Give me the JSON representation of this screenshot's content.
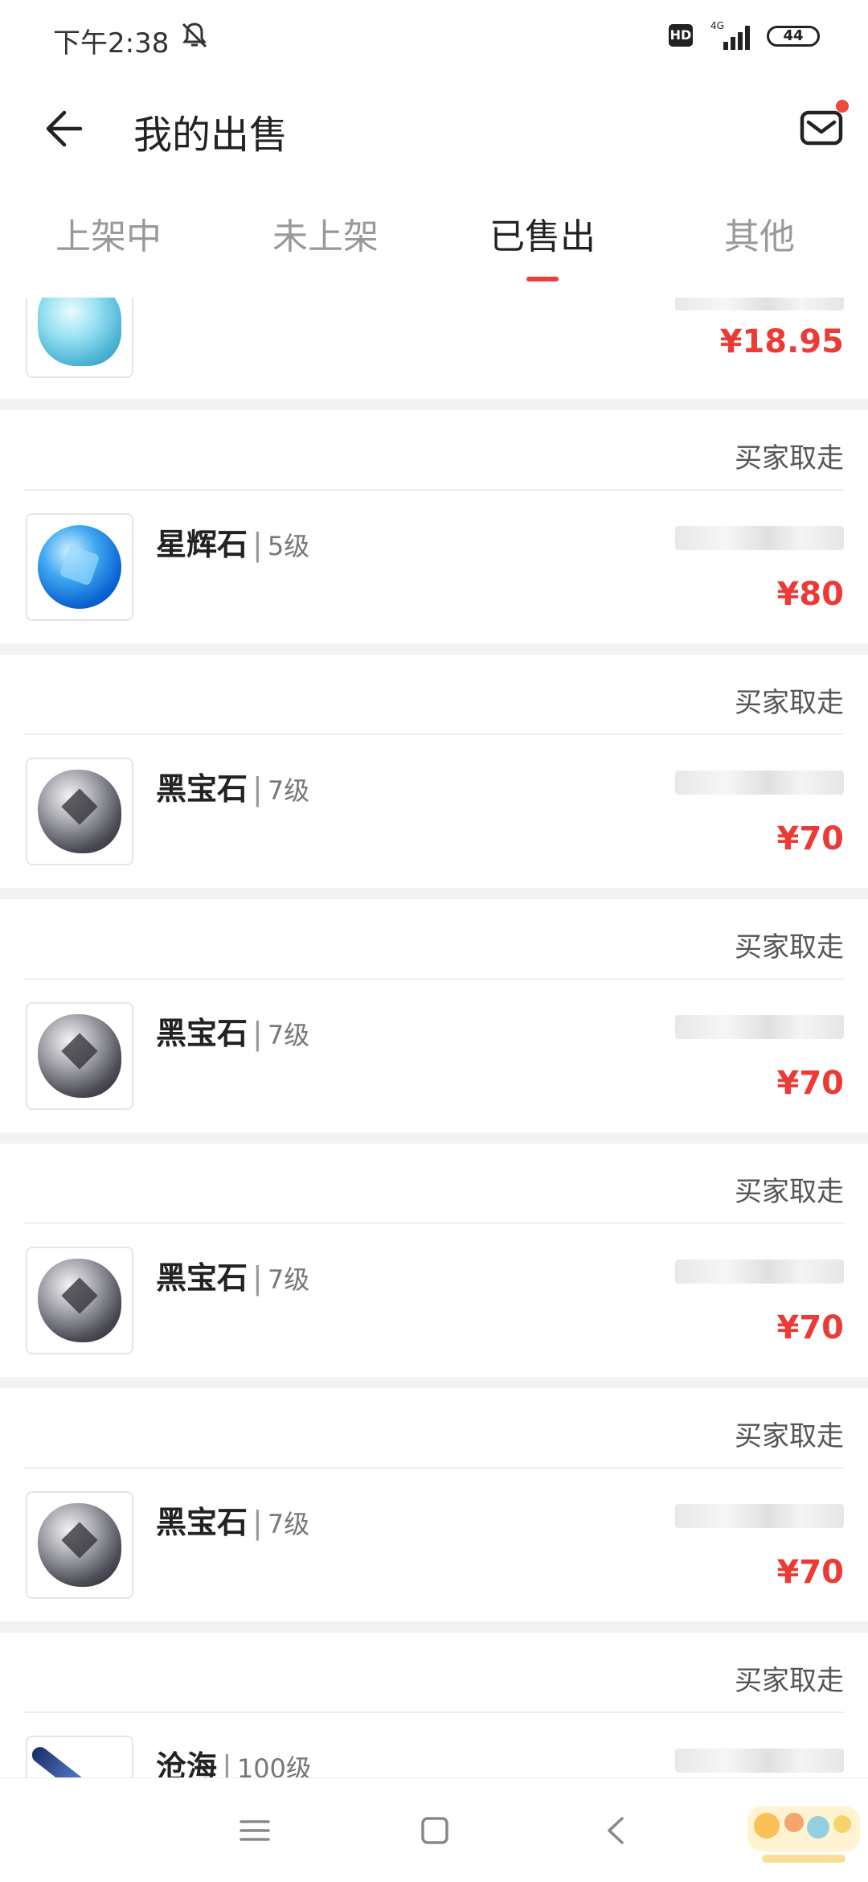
{
  "status_bar": {
    "time": "下午2:38",
    "hd": "HD",
    "network": "4G",
    "battery": "44"
  },
  "header": {
    "title": "我的出售"
  },
  "tabs": [
    {
      "label": "上架中",
      "active": false
    },
    {
      "label": "未上架",
      "active": false
    },
    {
      "label": "已售出",
      "active": true
    },
    {
      "label": "其他",
      "active": false
    }
  ],
  "items": [
    {
      "name": "",
      "level": "",
      "status": "",
      "price": "¥18.95",
      "icon": "ice-gem-icon"
    },
    {
      "name": "星辉石",
      "level": "5级",
      "status": "买家取走",
      "price": "¥80",
      "icon": "blue-gem-icon"
    },
    {
      "name": "黑宝石",
      "level": "7级",
      "status": "买家取走",
      "price": "¥70",
      "icon": "black-gem-icon"
    },
    {
      "name": "黑宝石",
      "level": "7级",
      "status": "买家取走",
      "price": "¥70",
      "icon": "black-gem-icon"
    },
    {
      "name": "黑宝石",
      "level": "7级",
      "status": "买家取走",
      "price": "¥70",
      "icon": "black-gem-icon"
    },
    {
      "name": "黑宝石",
      "level": "7级",
      "status": "买家取走",
      "price": "¥70",
      "icon": "black-gem-icon"
    },
    {
      "name": "沧海",
      "level": "100级",
      "status": "买家取走",
      "price": "",
      "icon": "staff-icon"
    }
  ],
  "colors": {
    "accent": "#e8413a",
    "price": "#ec3b36"
  }
}
